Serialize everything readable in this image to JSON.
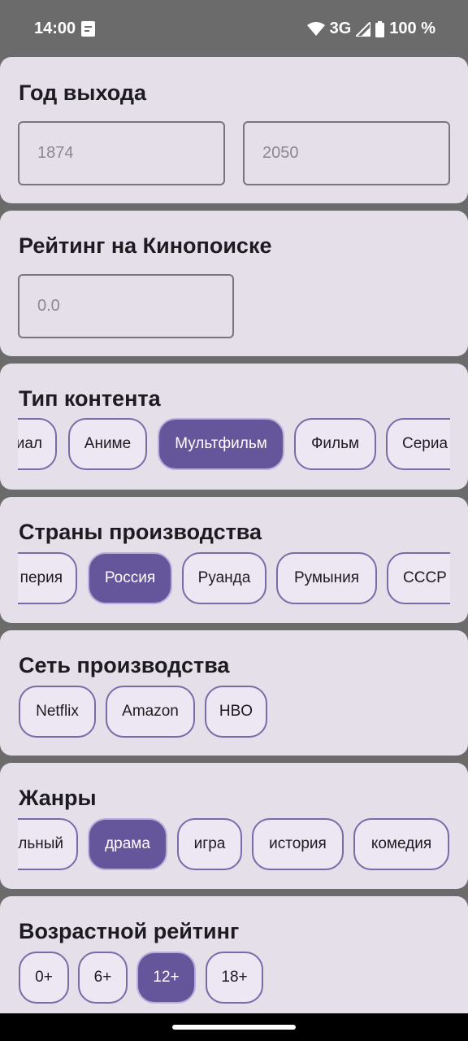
{
  "status": {
    "time": "14:00",
    "network": "3G",
    "battery": "100 %",
    "icons": [
      "notification-icon",
      "wifi-icon",
      "signal-icon",
      "battery-icon"
    ]
  },
  "year": {
    "title": "Год выхода",
    "from_placeholder": "1874",
    "to_placeholder": "2050"
  },
  "rating": {
    "title": "Рейтинг на Кинопоиске",
    "placeholder": "0.0"
  },
  "content_type": {
    "title": "Тип контента",
    "chips": [
      "иал",
      "Аниме",
      "Мультфильм",
      "Фильм",
      "Сериа"
    ],
    "selected": "Мультфильм"
  },
  "countries": {
    "title": "Страны производства",
    "chips": [
      "перия",
      "Россия",
      "Руанда",
      "Румыния",
      "СССР"
    ],
    "selected": "Россия"
  },
  "networks": {
    "title": "Сеть производства",
    "chips": [
      "Netflix",
      "Amazon",
      "HBO"
    ]
  },
  "genres": {
    "title": "Жанры",
    "chips": [
      "льный",
      "драма",
      "игра",
      "история",
      "комедия"
    ],
    "selected": "драма"
  },
  "age": {
    "title": "Возрастной рейтинг",
    "chips": [
      "0+",
      "6+",
      "12+",
      "18+"
    ],
    "selected": "12+"
  },
  "colors": {
    "card": "#e4dfe8",
    "chip_selected": "#65559a",
    "chip_border": "#7b6aa8",
    "status_bar": "#6b6b6b"
  }
}
